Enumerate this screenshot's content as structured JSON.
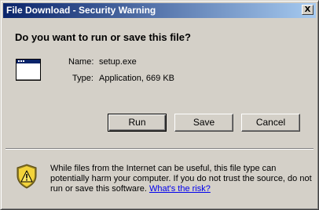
{
  "window": {
    "title": "File Download - Security Warning",
    "close_glyph": "X"
  },
  "question": "Do you want to run or save this file?",
  "file": {
    "icon": "application-window-icon",
    "name_label": "Name:",
    "name_value": "setup.exe",
    "type_label": "Type:",
    "type_value": "Application, 669 KB"
  },
  "buttons": {
    "run": "Run",
    "save": "Save",
    "cancel": "Cancel"
  },
  "warning": {
    "icon": "shield-warning-icon",
    "text": "While files from the Internet can be useful, this file type can potentially harm your computer. If you do not trust the source, do not run or save this software.",
    "link": "What's the risk?"
  }
}
